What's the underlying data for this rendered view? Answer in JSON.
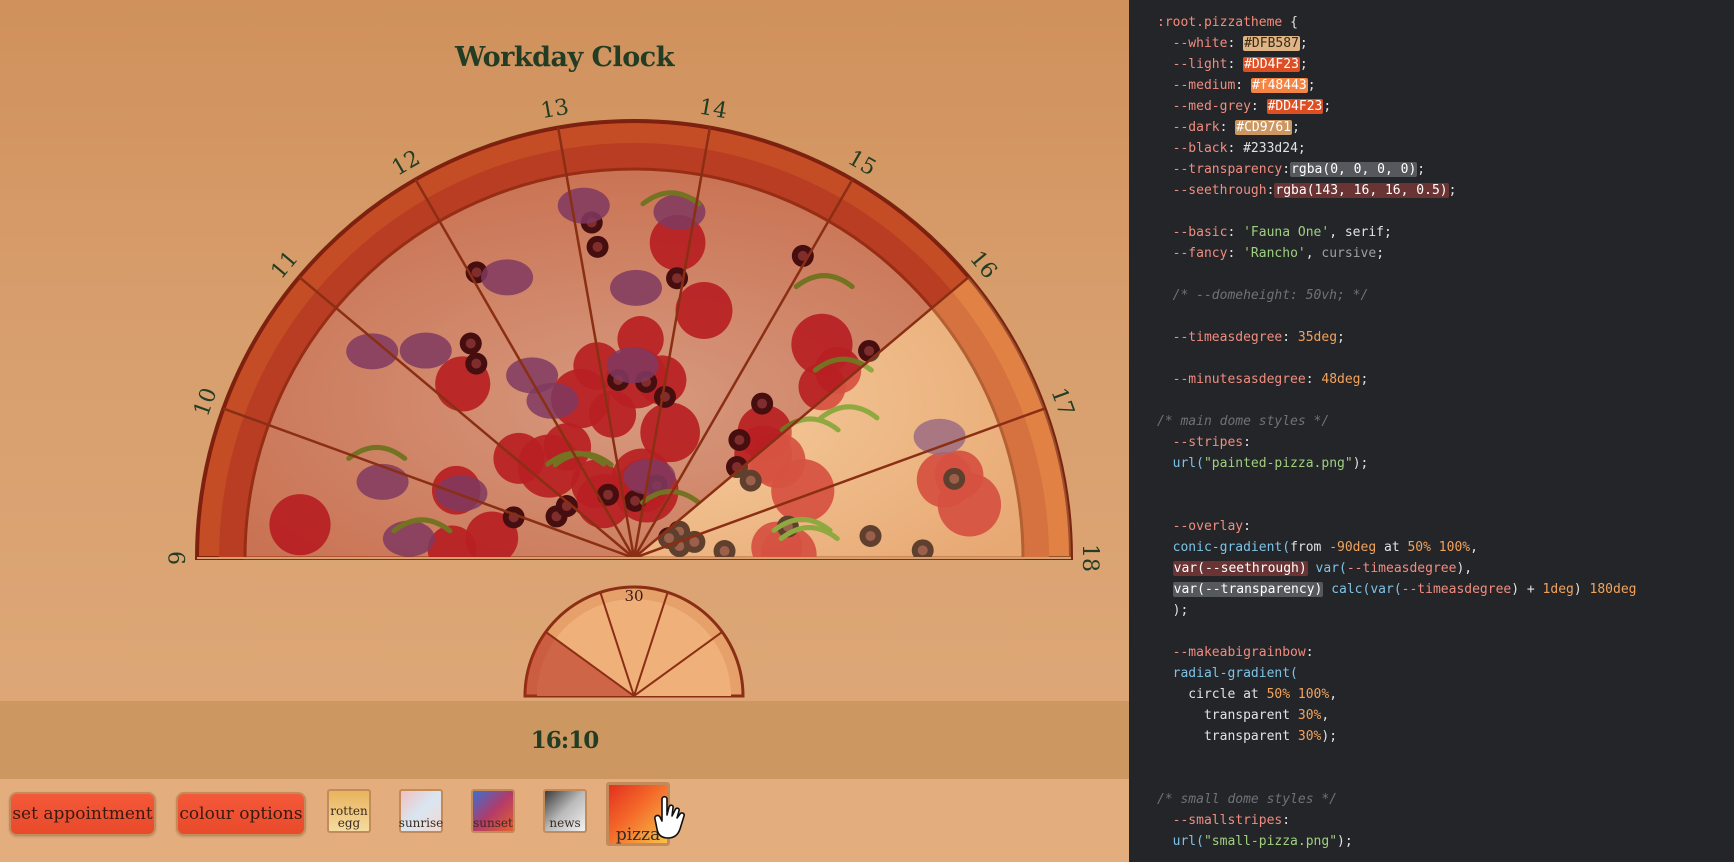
{
  "app": {
    "title": "Workday Clock",
    "hour_labels": [
      "9",
      "10",
      "11",
      "12",
      "13",
      "14",
      "15",
      "16",
      "17",
      "18"
    ],
    "minute_label": "30",
    "time": "16:10",
    "buttons": {
      "set_appointment": "set appointment",
      "colour_options": "colour options"
    },
    "themes": [
      {
        "label": "rotten egg",
        "line1": "rotten",
        "line2": "egg"
      },
      {
        "label": "sunrise"
      },
      {
        "label": "sunset"
      },
      {
        "label": "news"
      },
      {
        "label": "pizza",
        "selected": true
      }
    ],
    "colors": {
      "title": "#233d24",
      "bar": "#cd9761",
      "crust": "#d45a2c",
      "rim": "#8a2a12"
    }
  },
  "code_panel": {
    "lines": [
      [
        {
          "t": ":root.pizzatheme ",
          "c": "sel"
        },
        {
          "t": "{",
          "c": "punct"
        }
      ],
      [
        {
          "t": "  --white",
          "c": "prop"
        },
        {
          "t": ": ",
          "c": "punct"
        },
        {
          "t": "#DFB587",
          "c": "num",
          "bg": "#DFB587",
          "fg": "#3a2a10"
        },
        {
          "t": ";",
          "c": "punct"
        }
      ],
      [
        {
          "t": "  --light",
          "c": "prop"
        },
        {
          "t": ": ",
          "c": "punct"
        },
        {
          "t": "#DD4F23",
          "c": "num",
          "bg": "#DD4F23",
          "fg": "#ffffff"
        },
        {
          "t": ";",
          "c": "punct"
        }
      ],
      [
        {
          "t": "  --medium",
          "c": "prop"
        },
        {
          "t": ": ",
          "c": "punct"
        },
        {
          "t": "#f48443",
          "c": "num",
          "bg": "#f48443",
          "fg": "#ffffff"
        },
        {
          "t": ";",
          "c": "punct"
        }
      ],
      [
        {
          "t": "  --med-grey",
          "c": "prop"
        },
        {
          "t": ": ",
          "c": "punct"
        },
        {
          "t": "#DD4F23",
          "c": "num",
          "bg": "#DD4F23",
          "fg": "#ffffff"
        },
        {
          "t": ";",
          "c": "punct"
        }
      ],
      [
        {
          "t": "  --dark",
          "c": "prop"
        },
        {
          "t": ": ",
          "c": "punct"
        },
        {
          "t": "#CD9761",
          "c": "num",
          "bg": "#CD9761",
          "fg": "#ffffff"
        },
        {
          "t": ";",
          "c": "punct"
        }
      ],
      [
        {
          "t": "  --black",
          "c": "prop"
        },
        {
          "t": ": ",
          "c": "punct"
        },
        {
          "t": "#233d24",
          "c": "kw"
        },
        {
          "t": ";",
          "c": "punct"
        }
      ],
      [
        {
          "t": "  --transparency",
          "c": "prop"
        },
        {
          "t": ":",
          "c": "punct"
        },
        {
          "t": "rgba(0, 0, 0, 0)",
          "c": "kw",
          "bg": "#55585c",
          "fg": "#ffffff"
        },
        {
          "t": ";",
          "c": "punct"
        }
      ],
      [
        {
          "t": "  --seethrough",
          "c": "prop"
        },
        {
          "t": ":",
          "c": "punct"
        },
        {
          "t": "rgba(143, 16, 16, 0.5)",
          "c": "kw",
          "bg": "#6a3434",
          "fg": "#ffffff"
        },
        {
          "t": ";",
          "c": "punct"
        }
      ],
      [],
      [
        {
          "t": "  --basic",
          "c": "prop"
        },
        {
          "t": ": ",
          "c": "punct"
        },
        {
          "t": "'Fauna One'",
          "c": "str"
        },
        {
          "t": ", serif;",
          "c": "punct"
        }
      ],
      [
        {
          "t": "  --fancy",
          "c": "prop"
        },
        {
          "t": ": ",
          "c": "punct"
        },
        {
          "t": "'Rancho'",
          "c": "str"
        },
        {
          "t": ", ",
          "c": "punct"
        },
        {
          "t": "cursive",
          "c": "dim"
        },
        {
          "t": ";",
          "c": "punct"
        }
      ],
      [],
      [
        {
          "t": "  /* --domeheight: 50vh; */",
          "c": "com"
        }
      ],
      [],
      [
        {
          "t": "  --timeasdegree",
          "c": "prop"
        },
        {
          "t": ": ",
          "c": "punct"
        },
        {
          "t": "35deg",
          "c": "num"
        },
        {
          "t": ";",
          "c": "punct"
        }
      ],
      [],
      [
        {
          "t": "  --minutesasdegree",
          "c": "prop"
        },
        {
          "t": ": ",
          "c": "punct"
        },
        {
          "t": "48deg",
          "c": "num"
        },
        {
          "t": ";",
          "c": "punct"
        }
      ],
      [],
      [
        {
          "t": "/* main dome styles */",
          "c": "com"
        }
      ],
      [
        {
          "t": "  --stripes",
          "c": "prop"
        },
        {
          "t": ":",
          "c": "punct"
        }
      ],
      [
        {
          "t": "  url(",
          "c": "fn"
        },
        {
          "t": "\"painted-pizza.png\"",
          "c": "str"
        },
        {
          "t": ");",
          "c": "punct"
        }
      ],
      [],
      [],
      [
        {
          "t": "  --overlay",
          "c": "prop"
        },
        {
          "t": ":",
          "c": "punct"
        }
      ],
      [
        {
          "t": "  conic-gradient(",
          "c": "fn"
        },
        {
          "t": "from ",
          "c": "kw"
        },
        {
          "t": "-90deg",
          "c": "num"
        },
        {
          "t": " at ",
          "c": "kw"
        },
        {
          "t": "50% 100%",
          "c": "num"
        },
        {
          "t": ",",
          "c": "punct"
        }
      ],
      [
        {
          "t": "  ",
          "c": "punct"
        },
        {
          "t": "var(--seethrough)",
          "c": "kw",
          "bg": "#6a3434",
          "fg": "#ffffff"
        },
        {
          "t": " var(",
          "c": "fn"
        },
        {
          "t": "--timeasdegree",
          "c": "prop"
        },
        {
          "t": "),",
          "c": "punct"
        }
      ],
      [
        {
          "t": "  ",
          "c": "punct"
        },
        {
          "t": "var(--transparency)",
          "c": "kw",
          "bg": "#55585c",
          "fg": "#ffffff"
        },
        {
          "t": " calc(var(",
          "c": "fn"
        },
        {
          "t": "--timeasdegree",
          "c": "prop"
        },
        {
          "t": ") + ",
          "c": "punct"
        },
        {
          "t": "1deg",
          "c": "num"
        },
        {
          "t": ") ",
          "c": "punct"
        },
        {
          "t": "180deg",
          "c": "num"
        }
      ],
      [
        {
          "t": "  );",
          "c": "punct"
        }
      ],
      [],
      [
        {
          "t": "  --makeabigrainbow",
          "c": "prop"
        },
        {
          "t": ":",
          "c": "punct"
        }
      ],
      [
        {
          "t": "  radial-gradient(",
          "c": "fn"
        }
      ],
      [
        {
          "t": "    circle ",
          "c": "kw"
        },
        {
          "t": "at ",
          "c": "kw"
        },
        {
          "t": "50% 100%",
          "c": "num"
        },
        {
          "t": ",",
          "c": "punct"
        }
      ],
      [
        {
          "t": "      transparent ",
          "c": "kw"
        },
        {
          "t": "30%",
          "c": "num"
        },
        {
          "t": ",",
          "c": "punct"
        }
      ],
      [
        {
          "t": "      transparent ",
          "c": "kw"
        },
        {
          "t": "30%",
          "c": "num"
        },
        {
          "t": ");",
          "c": "punct"
        }
      ],
      [],
      [],
      [
        {
          "t": "/* small dome styles */",
          "c": "com"
        }
      ],
      [
        {
          "t": "  --smallstripes",
          "c": "prop"
        },
        {
          "t": ":",
          "c": "punct"
        }
      ],
      [
        {
          "t": "  url(",
          "c": "fn"
        },
        {
          "t": "\"small-pizza.png\"",
          "c": "str"
        },
        {
          "t": ");",
          "c": "punct"
        }
      ]
    ]
  }
}
